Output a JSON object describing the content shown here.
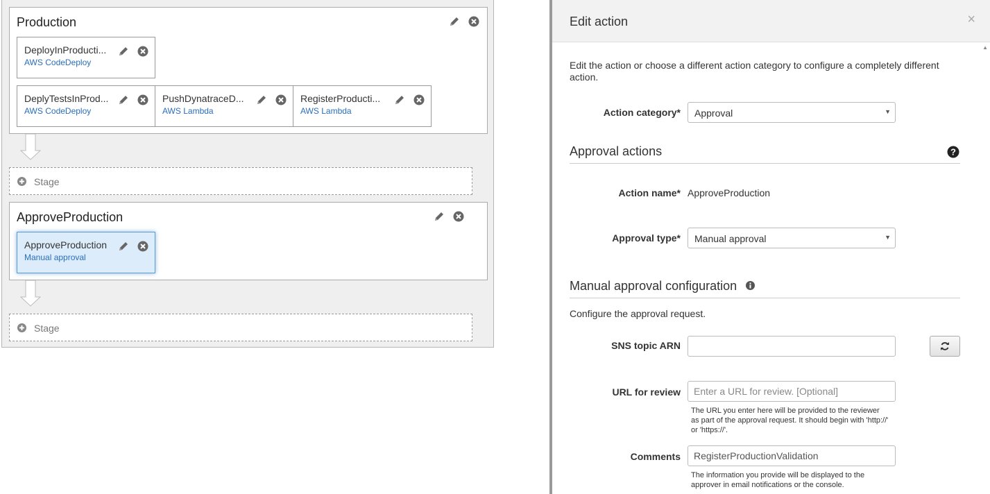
{
  "pipeline": {
    "production_stage": {
      "title": "Production",
      "row1": [
        {
          "name": "DeployInProducti...",
          "provider": "AWS CodeDeploy"
        }
      ],
      "row2": [
        {
          "name": "DeplyTestsInProd...",
          "provider": "AWS CodeDeploy"
        },
        {
          "name": "PushDynatraceD...",
          "provider": "AWS Lambda"
        },
        {
          "name": "RegisterProducti...",
          "provider": "AWS Lambda"
        }
      ]
    },
    "add_stage_label": "Stage",
    "approve_stage": {
      "title": "ApproveProduction",
      "action": {
        "name": "ApproveProduction",
        "provider": "Manual approval"
      }
    }
  },
  "edit": {
    "title": "Edit action",
    "close": "×",
    "intro": "Edit the action or choose a different action category to configure a completely different action.",
    "category_label": "Action category*",
    "category_value": "Approval",
    "approval_section": "Approval actions",
    "action_name_label": "Action name*",
    "action_name_value": "ApproveProduction",
    "approval_type_label": "Approval type*",
    "approval_type_value": "Manual approval",
    "manual_section": "Manual approval configuration",
    "config_intro": "Configure the approval request.",
    "sns_label": "SNS topic ARN",
    "sns_value": "",
    "url_label": "URL for review",
    "url_placeholder": "Enter a URL for review. [Optional]",
    "url_help": "The URL you enter here will be provided to the reviewer as part of the approval request. It should begin with 'http://' or 'https://'.",
    "comments_label": "Comments",
    "comments_value": "RegisterProductionValidation",
    "comments_help": "The information you provide will be displayed to the approver in email notifications or the console."
  },
  "colors": {
    "link_blue": "#2a6ebb",
    "selected_bg": "#dcecfb",
    "selected_border": "#5b9bd5"
  }
}
